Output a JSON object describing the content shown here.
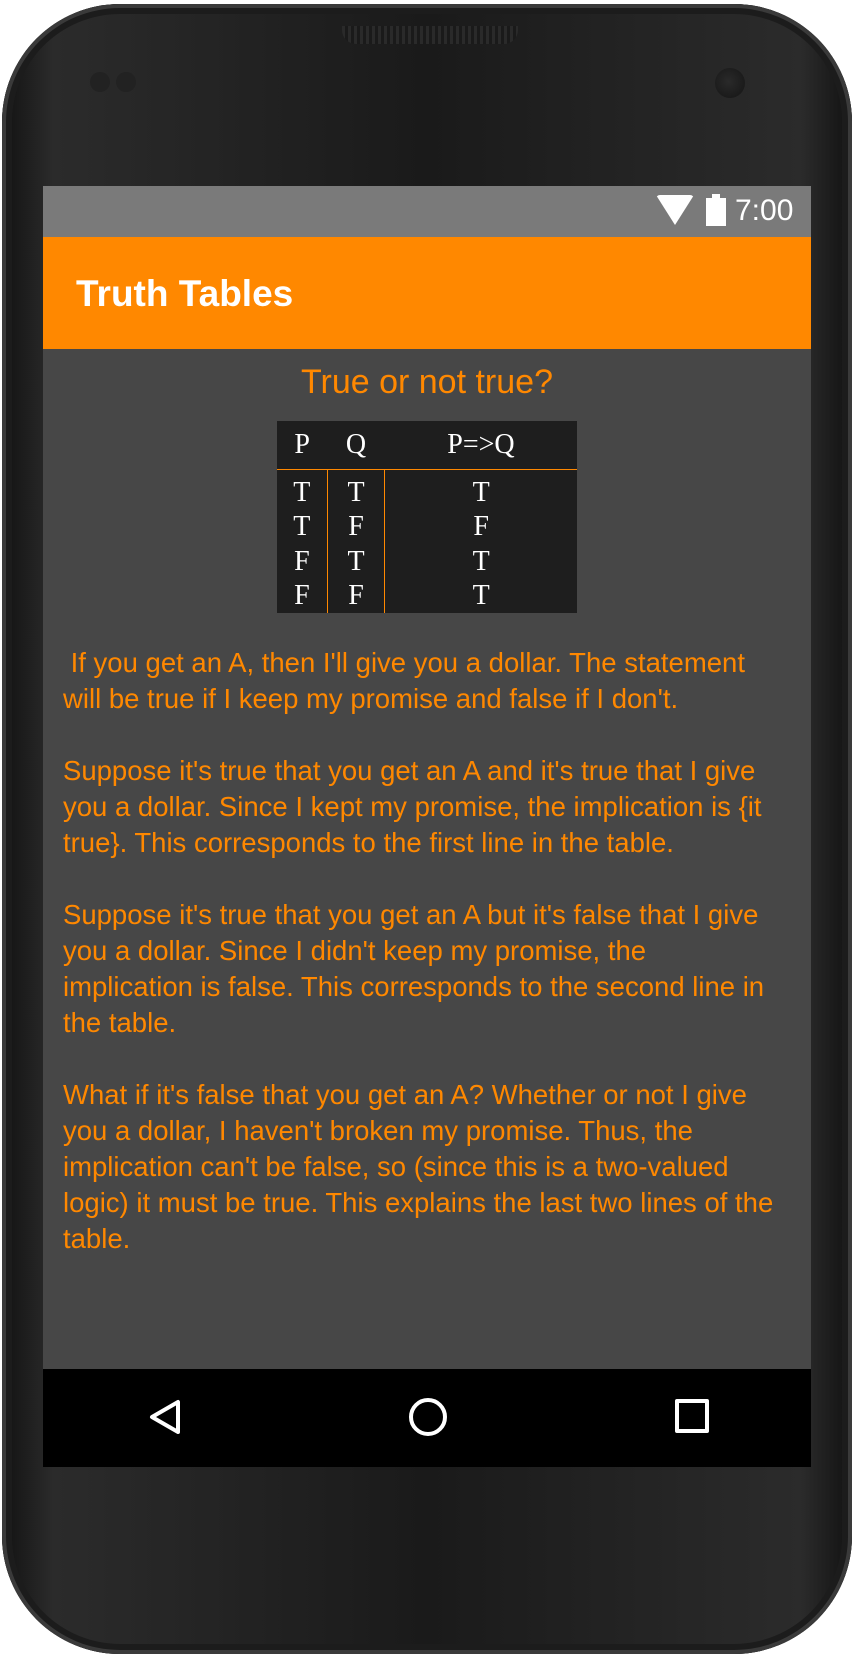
{
  "status_bar": {
    "time": "7:00",
    "icons": [
      "wifi-icon",
      "battery-icon"
    ]
  },
  "app_bar": {
    "title": "Truth Tables",
    "color": "#ff8800"
  },
  "content": {
    "question": "True or not true?",
    "table": {
      "headers": [
        "P",
        "Q",
        "P=>Q"
      ],
      "rows": [
        [
          "T",
          "T",
          "T"
        ],
        [
          "T",
          "F",
          "F"
        ],
        [
          "F",
          "T",
          "T"
        ],
        [
          "F",
          "F",
          "T"
        ]
      ]
    },
    "paragraphs": [
      " If you get an A, then I'll give you a dollar. The statement will be true if I keep my promise and false if I don't.",
      "Suppose it's true that you get an A and it's true that I give you a dollar. Since I kept my promise, the implication is {it true}. This corresponds to the first line in the table.",
      "Suppose it's true that you get an A but it's false that I give you a dollar. Since I didn't keep my promise, the implication is false. This corresponds to the second line in the table.",
      "What if it's false that you get an A? Whether or not I give you a dollar, I haven't broken my promise. Thus, the implication can't be false, so (since this is a two-valued logic) it must be true. This explains the last two lines of the table."
    ]
  },
  "nav_bar": {
    "buttons": [
      "back-icon",
      "home-icon",
      "recent-apps-icon"
    ]
  },
  "colors": {
    "accent": "#ff8800",
    "background": "#474747",
    "status_bar": "#7a7a7a",
    "table_background": "#1e1e1e"
  }
}
